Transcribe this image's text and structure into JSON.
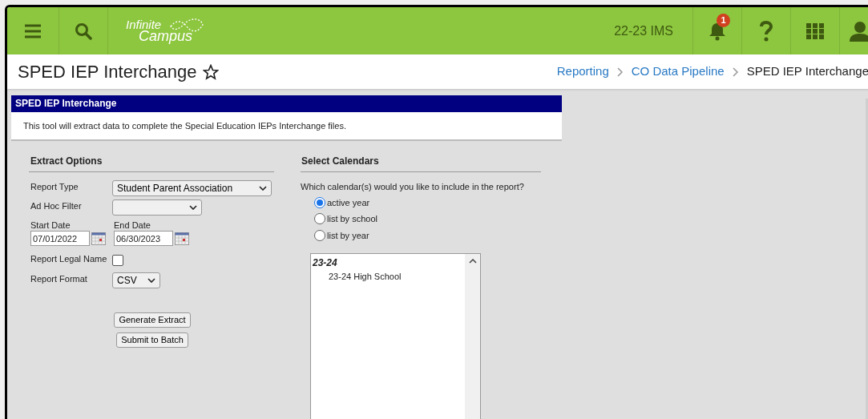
{
  "header": {
    "logo": {
      "line1": "Infinite",
      "line2": "Campus"
    },
    "context": "22-23 IMS",
    "notification_count": "1"
  },
  "page": {
    "title": "SPED IEP Interchange",
    "favorite": false,
    "breadcrumbs": [
      {
        "label": "Reporting",
        "kind": "link"
      },
      {
        "label": "CO Data Pipeline",
        "kind": "link"
      },
      {
        "label": "SPED IEP Interchange",
        "kind": "current"
      }
    ]
  },
  "panel": {
    "title": "SPED IEP Interchange",
    "description": "This tool will extract data to complete the Special Education IEPs Interchange files."
  },
  "extract_options": {
    "heading": "Extract Options",
    "report_type": {
      "label": "Report Type",
      "value": "Student Parent Association"
    },
    "ad_hoc_filter": {
      "label": "Ad Hoc Filter"
    },
    "start_date": {
      "label": "Start Date",
      "value": "07/01/2022"
    },
    "end_date": {
      "label": "End Date",
      "value": "06/30/2023"
    },
    "report_legal_name": {
      "label": "Report Legal Name",
      "checked": false
    },
    "report_format": {
      "label": "Report Format",
      "value": "CSV"
    },
    "buttons": [
      "Generate Extract",
      "Submit to Batch"
    ]
  },
  "select_calendars": {
    "heading": "Select Calendars",
    "question": "Which calendar(s) would you like to include in the report?",
    "options": [
      {
        "label": "active year",
        "selected": true
      },
      {
        "label": "list by school",
        "selected": false
      },
      {
        "label": "list by year",
        "selected": false
      }
    ],
    "calendar_list": [
      {
        "year": "23-24",
        "calendars": [
          "23-24 High School"
        ]
      }
    ]
  }
}
